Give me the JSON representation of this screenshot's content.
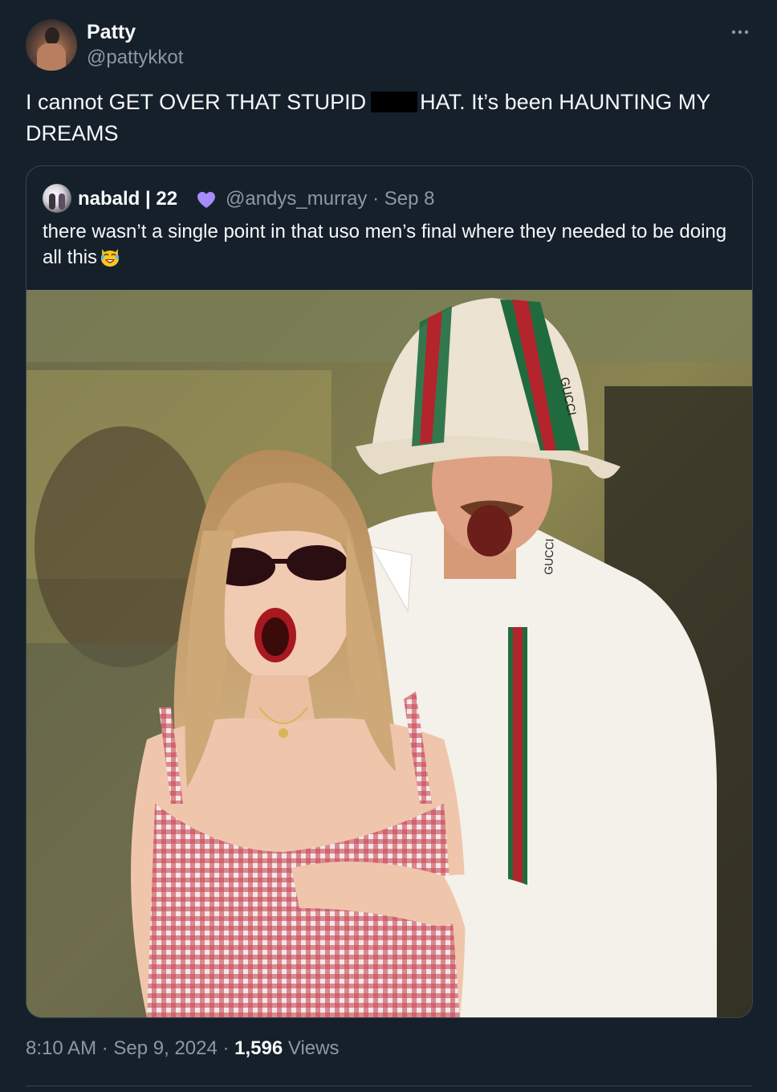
{
  "tweet": {
    "author": {
      "name": "Patty",
      "handle": "@pattykkot"
    },
    "more_icon": "more-horizontal-icon",
    "text_before_redaction": "I cannot GET OVER THAT STUPID",
    "text_after_redaction": "HAT. It’s been HAUNTING MY DREAMS",
    "timestamp": "8:10 AM · Sep 9, 2024 · ",
    "views_count": "1,596",
    "views_label": " Views"
  },
  "quote": {
    "author_name": "nabald | 22",
    "author_badge_icon": "purple-heart-icon",
    "author_handle_and_date": "@andys_murray · Sep 8",
    "text": "there wasn’t a single point in that uso men’s final where they needed to be doing all this",
    "emoji_icon": "laughing-cat-emoji-icon",
    "image_description_icon": "photo",
    "image_text_hat": "GUCCI",
    "image_text_collar": "GUCCI"
  },
  "colors": {
    "background": "#15202b",
    "text_primary": "#f7f9f9",
    "text_secondary": "#8b98a5",
    "border": "#38444d",
    "heart": "#a78bfa"
  }
}
